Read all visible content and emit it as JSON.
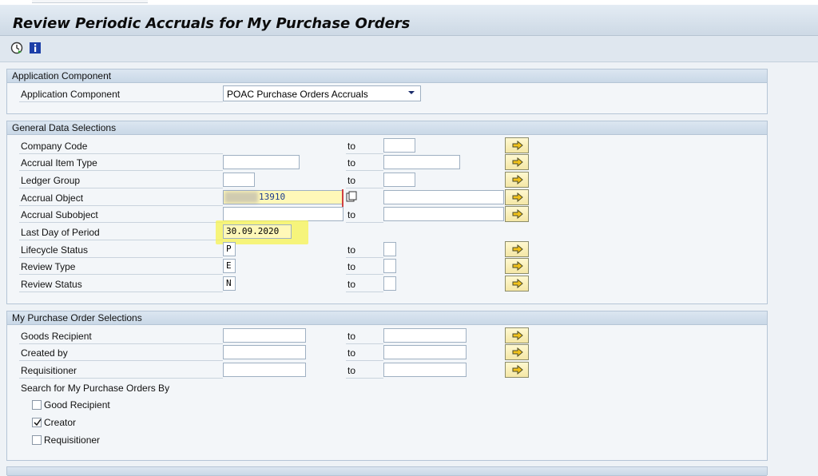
{
  "title": "Review Periodic Accruals for My Purchase Orders",
  "toolbar": {
    "execute_icon": "clock-execute-icon",
    "info_icon": "info-icon"
  },
  "groups": {
    "app_component": {
      "title": "Application Component",
      "label": "Application Component",
      "selected": "POAC Purchase Orders Accruals"
    },
    "general": {
      "title": "General Data Selections",
      "to_label": "to",
      "company_code": {
        "label": "Company Code",
        "value": ""
      },
      "accrual_item_type": {
        "label": "Accrual Item Type",
        "value": ""
      },
      "ledger_group": {
        "label": "Ledger Group",
        "value": ""
      },
      "accrual_object": {
        "label": "Accrual Object",
        "value": "13910"
      },
      "accrual_subobject": {
        "label": "Accrual Subobject",
        "value": ""
      },
      "last_day_of_period": {
        "label": "Last Day of Period",
        "value": "30.09.2020"
      },
      "lifecycle_status": {
        "label": "Lifecycle Status",
        "value": "P"
      },
      "review_type": {
        "label": "Review Type",
        "value": "E"
      },
      "review_status": {
        "label": "Review Status",
        "value": "N"
      }
    },
    "my_po": {
      "title": "My Purchase Order Selections",
      "to_label": "to",
      "goods_recipient": {
        "label": "Goods Recipient"
      },
      "created_by": {
        "label": "Created by"
      },
      "requisitioner": {
        "label": "Requisitioner"
      },
      "search_by_label": "Search for My Purchase Orders By",
      "options": [
        {
          "label": "Good Recipient",
          "checked": false
        },
        {
          "label": "Creator",
          "checked": true
        },
        {
          "label": "Requisitioner",
          "checked": false
        }
      ]
    }
  },
  "colors": {
    "highlight": "#f7f350",
    "header": "#c9d8e7",
    "group_border": "#b5c5d6"
  }
}
